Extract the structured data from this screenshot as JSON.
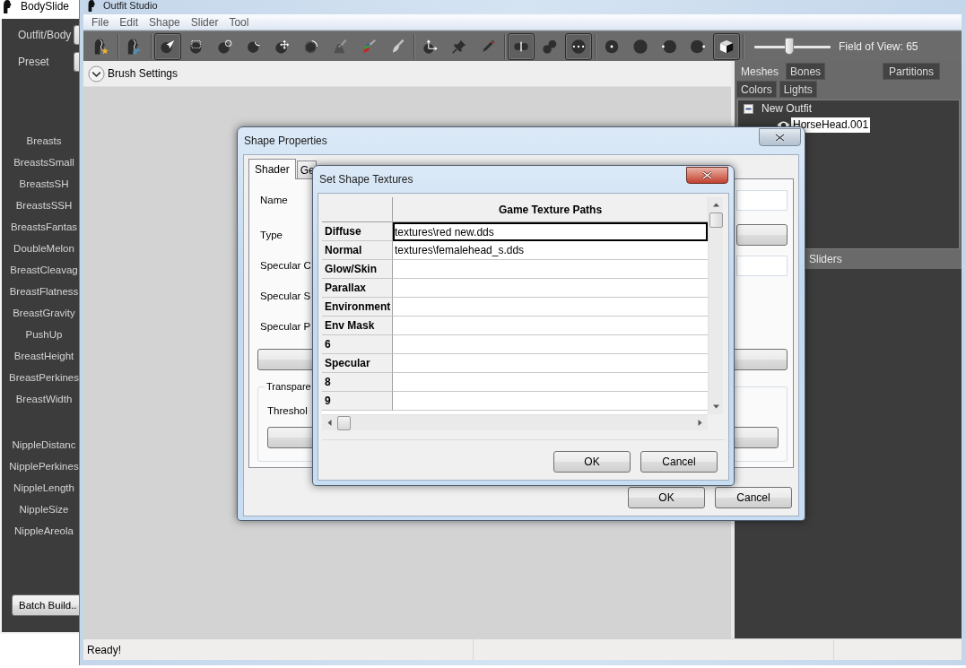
{
  "bodyslide": {
    "title": "BodySlide",
    "fields": [
      {
        "label": "Outfit/Body"
      },
      {
        "label": "Preset"
      }
    ],
    "slider_groups": [
      [
        "Breasts",
        "BreastsSmall",
        "BreastsSH",
        "BreastsSSH",
        "BreastsFantas",
        "DoubleMelon",
        "BreastCleavag",
        "BreastFlatness",
        "BreastGravity",
        "PushUp",
        "BreastHeight",
        "BreastPerkines",
        "BreastWidth"
      ],
      [
        "NippleDistanc",
        "NipplePerkines",
        "NippleLength",
        "NippleSize",
        "NippleAreola"
      ]
    ],
    "batch_button": "Batch Build.."
  },
  "outfit_studio": {
    "title": "Outfit Studio",
    "menu": [
      "File",
      "Edit",
      "Shape",
      "Slider",
      "Tool"
    ],
    "toolbar": [
      [
        {
          "kind": "preset",
          "selected": false
        }
      ],
      [
        {
          "kind": "outline",
          "selected": false
        }
      ],
      [
        {
          "kind": "select",
          "selected": true
        },
        {
          "kind": "mask",
          "selected": false
        },
        {
          "kind": "inflate",
          "selected": false
        },
        {
          "kind": "deflate",
          "selected": false
        },
        {
          "kind": "move",
          "selected": false
        },
        {
          "kind": "smooth",
          "selected": false
        },
        {
          "kind": "weight",
          "selected": false
        },
        {
          "kind": "color",
          "selected": false
        },
        {
          "kind": "alpha",
          "selected": false
        }
      ],
      [
        {
          "kind": "transform",
          "selected": false
        },
        {
          "kind": "pivot",
          "selected": false
        },
        {
          "kind": "pen",
          "selected": false
        }
      ],
      [
        {
          "kind": "mirror",
          "selected": true
        },
        {
          "kind": "connected",
          "selected": false
        },
        {
          "kind": "xray",
          "selected": true
        }
      ],
      [
        {
          "kind": "centerdot",
          "selected": false
        },
        {
          "kind": "sphere",
          "selected": false
        },
        {
          "kind": "leftdot",
          "selected": false
        },
        {
          "kind": "rightdot",
          "selected": false
        },
        {
          "kind": "cube",
          "selected": true
        }
      ]
    ],
    "fov": {
      "level": 0.46,
      "label": "Field of View: 65"
    },
    "brush_settings": "Brush Settings",
    "panel_tabs": [
      [
        {
          "label": "Meshes",
          "selected": true
        },
        {
          "label": "Bones",
          "selected": false
        },
        {
          "label": "Partitions",
          "selected": false
        }
      ],
      [
        {
          "label": "Colors",
          "selected": false
        },
        {
          "label": "Lights",
          "selected": false
        }
      ]
    ],
    "tree": [
      {
        "label": "New Outfit",
        "expanded": true,
        "selected": false,
        "children": [
          {
            "label": "HorseHead.001",
            "selected": true
          }
        ]
      }
    ],
    "sliders_bar": "Sliders",
    "status_bar": "Ready!"
  },
  "shape_properties": {
    "title": "Shape Properties",
    "tabs": [
      {
        "label": "Shader",
        "selected": true
      },
      {
        "label": "Ge",
        "selected": false
      }
    ],
    "fields": [
      {
        "label": "Name",
        "kind": "text"
      },
      {
        "label": "Type",
        "kind": "dropdown"
      },
      {
        "label": "Specular C",
        "kind": "text"
      },
      {
        "label": "Specular S"
      },
      {
        "label": "Specular P"
      }
    ],
    "transparency": {
      "label": "Transpare",
      "threshold_label": "Threshol"
    },
    "buttons": [
      "OK",
      "Cancel"
    ]
  },
  "set_shape_textures": {
    "title": "Set Shape Textures",
    "column": "Game Texture Paths",
    "rows": [
      {
        "label": "Diffuse",
        "value": "textures\\red new.dds",
        "editing": true
      },
      {
        "label": "Normal",
        "value": "textures\\femalehead_s.dds",
        "editing": false
      },
      {
        "label": "Glow/Skin",
        "editing": false
      },
      {
        "label": "Parallax",
        "editing": false
      },
      {
        "label": "Environment",
        "editing": false
      },
      {
        "label": "Env Mask",
        "editing": false
      },
      {
        "label": "6",
        "editing": false
      },
      {
        "label": "Specular",
        "editing": false
      },
      {
        "label": "8",
        "editing": false
      },
      {
        "label": "9",
        "editing": false
      }
    ],
    "buttons": [
      "OK",
      "Cancel"
    ]
  }
}
